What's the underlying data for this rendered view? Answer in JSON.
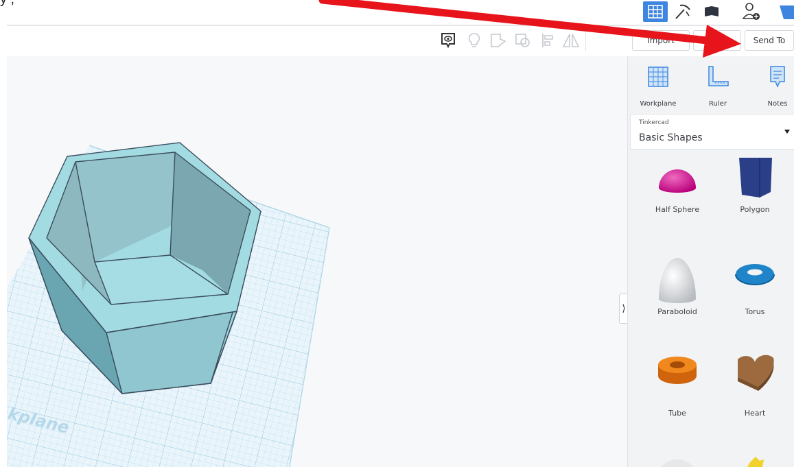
{
  "top": {
    "caption": "y                                                ,"
  },
  "toolbar": {
    "import_label": "Import",
    "export_label": "Exp",
    "sendto_label": "Send To"
  },
  "panel": {
    "tools": [
      {
        "label": "Workplane"
      },
      {
        "label": "Ruler"
      },
      {
        "label": "Notes"
      }
    ],
    "library": {
      "source": "Tinkercad",
      "category": "Basic Shapes"
    },
    "shapes": [
      {
        "label": "Half Sphere"
      },
      {
        "label": "Polygon"
      },
      {
        "label": "Paraboloid"
      },
      {
        "label": "Torus"
      },
      {
        "label": "Tube"
      },
      {
        "label": "Heart"
      }
    ]
  },
  "canvas": {
    "workplane_label": "kplane"
  },
  "colors": {
    "accent": "#3e85e0",
    "arrow": "#e8141b",
    "part": "#a3dbe3"
  }
}
